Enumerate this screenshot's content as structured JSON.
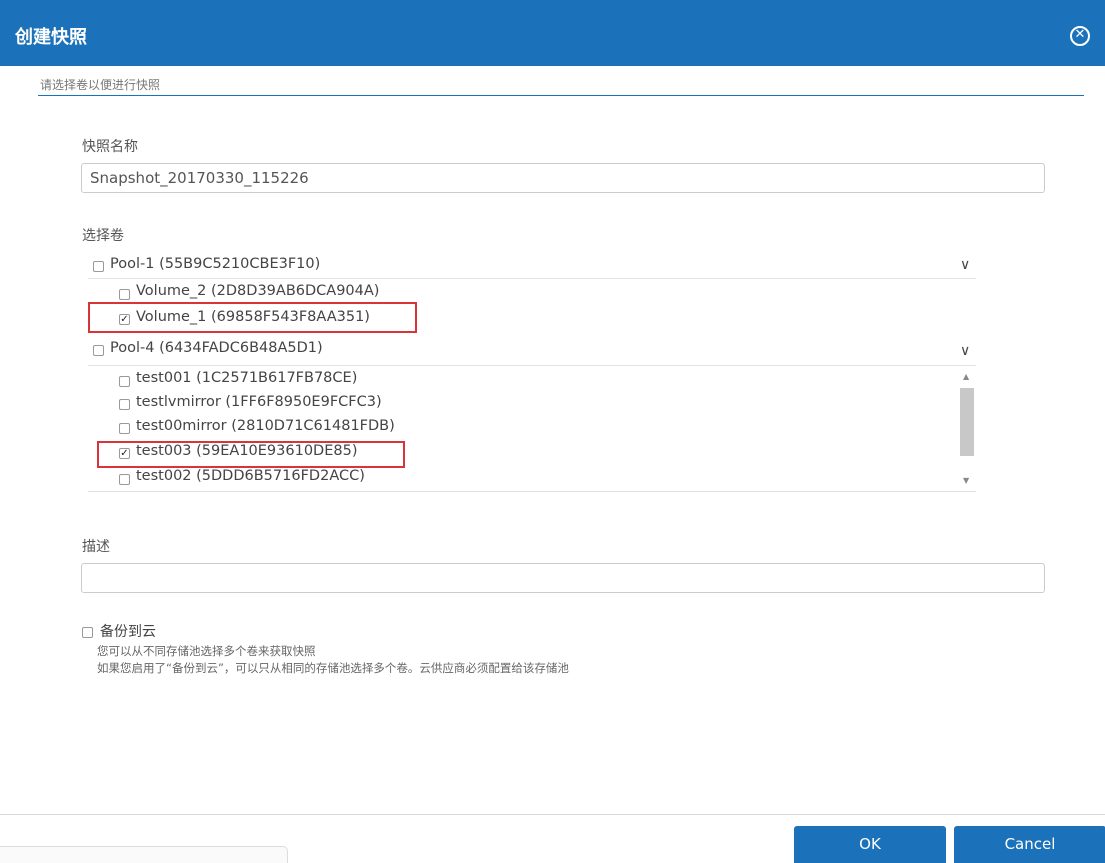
{
  "dialog": {
    "title": "创建快照",
    "subtitle": "请选择卷以便进行快照"
  },
  "snapshot_name": {
    "label": "快照名称",
    "value": "Snapshot_20170330_115226"
  },
  "volume_select": {
    "label": "选择卷",
    "pools": [
      {
        "label": "Pool-1 (55B9C5210CBE3F10)",
        "checked": false,
        "volumes": [
          {
            "label": "Volume_2 (2D8D39AB6DCA904A)",
            "checked": false
          },
          {
            "label": "Volume_1 (69858F543F8AA351)",
            "checked": true
          }
        ]
      },
      {
        "label": "Pool-4 (6434FADC6B48A5D1)",
        "checked": false,
        "volumes": [
          {
            "label": "test001 (1C2571B617FB78CE)",
            "checked": false
          },
          {
            "label": "testlvmirror (1FF6F8950E9FCFC3)",
            "checked": false
          },
          {
            "label": "test00mirror (2810D71C61481FDB)",
            "checked": false
          },
          {
            "label": "test003 (59EA10E93610DE85)",
            "checked": true
          },
          {
            "label": "test002 (5DDD6B5716FD2ACC)",
            "checked": false
          }
        ]
      }
    ]
  },
  "description": {
    "label": "描述",
    "value": ""
  },
  "backup": {
    "label": "备份到云",
    "checked": false,
    "hint1": "您可以从不同存储池选择多个卷来获取快照",
    "hint2": "如果您启用了“备份到云”，可以只从相同的存储池选择多个卷。云供应商必须配置给该存储池"
  },
  "buttons": {
    "ok": "OK",
    "cancel": "Cancel"
  },
  "colors": {
    "accent": "#1b72ba",
    "highlight": "#d9343a"
  }
}
